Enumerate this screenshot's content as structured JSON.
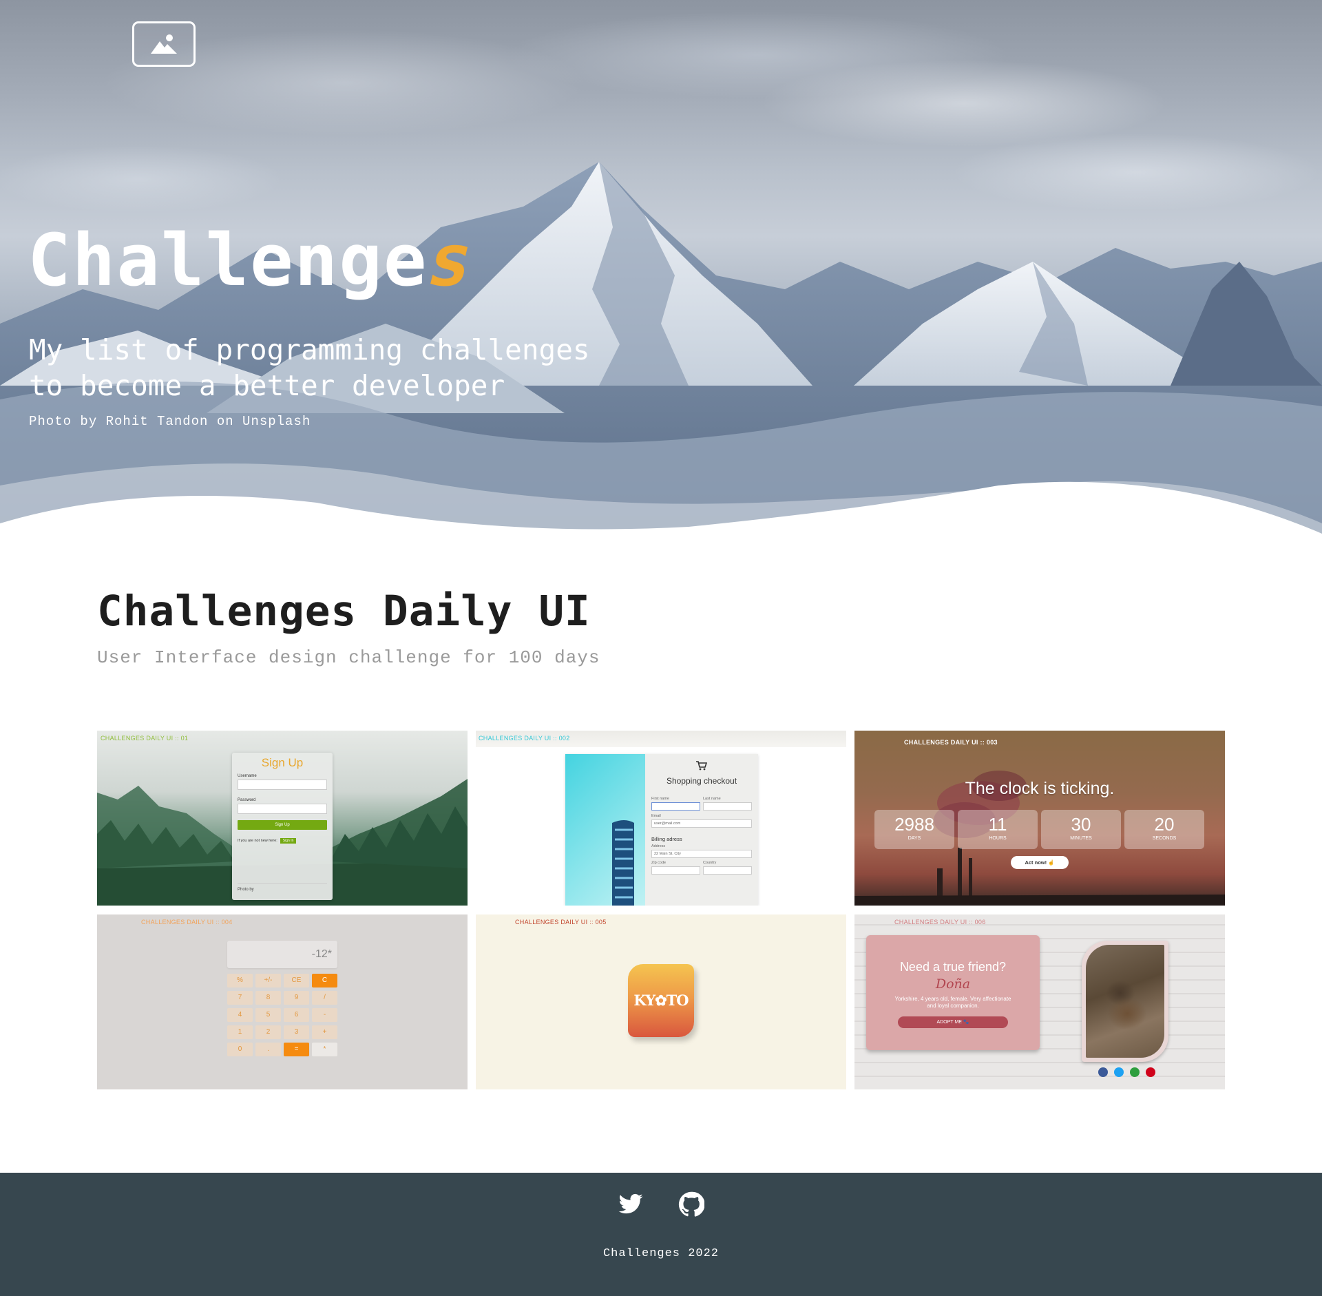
{
  "hero": {
    "title_main": "Challenge",
    "title_accent": "s",
    "subtitle": "My list of programming challenges\nto become a better developer",
    "credit": "Photo by Rohit Tandon on Unsplash",
    "logo_icon": "image-icon"
  },
  "section": {
    "title": "Challenges Daily UI",
    "subtitle": "User Interface design challenge for 100 days"
  },
  "cards": [
    {
      "tag": "CHALLENGES DAILY UI :: 01",
      "heading": "Sign Up",
      "username_label": "Username",
      "password_label": "Password",
      "button": "Sign Up",
      "not_new": "If you are not new here:",
      "signin": "Sign In",
      "credit": "Photo by"
    },
    {
      "tag": "CHALLENGES DAILY UI :: 002",
      "heading": "Shopping checkout",
      "first_name": "First name",
      "last_name": "Last name",
      "email": "Email",
      "email_placeholder": "user@mail.com",
      "billing": "Billing adress",
      "address": "Address",
      "address_placeholder": "22 Main St. City",
      "zip": "Zip code",
      "country": "Country"
    },
    {
      "tag": "CHALLENGES DAILY UI :: 003",
      "heading": "The clock is ticking.",
      "countdown": [
        {
          "value": "2988",
          "label": "DAYS"
        },
        {
          "value": "11",
          "label": "HOURS"
        },
        {
          "value": "30",
          "label": "MINUTES"
        },
        {
          "value": "20",
          "label": "SECONDS"
        }
      ],
      "button": "Act now!"
    },
    {
      "tag": "CHALLENGES DAILY UI :: 004",
      "display": "-12*",
      "keys": [
        "%",
        "+/-",
        "CE",
        "C",
        "7",
        "8",
        "9",
        "/",
        "4",
        "5",
        "6",
        "-",
        "1",
        "2",
        "3",
        "+",
        "0",
        ".",
        "=",
        "*"
      ]
    },
    {
      "tag": "CHALLENGES DAILY UI :: 005",
      "logo_text": "KY✿TO"
    },
    {
      "tag": "CHALLENGES DAILY UI :: 006",
      "question": "Need a true friend?",
      "name": "Doña",
      "description": "Yorkshire, 4 years old, female. Very affectionate and loyal companion.",
      "button": "ADOPT ME",
      "social_colors": [
        "#3b5998",
        "#1da1f2",
        "#2e9e3e",
        "#d0021b"
      ]
    }
  ],
  "footer": {
    "copyright": "Challenges 2022",
    "icons": [
      "twitter-icon",
      "github-icon"
    ]
  },
  "colors": {
    "accent": "#f0a830",
    "footer_bg": "#37474f"
  }
}
